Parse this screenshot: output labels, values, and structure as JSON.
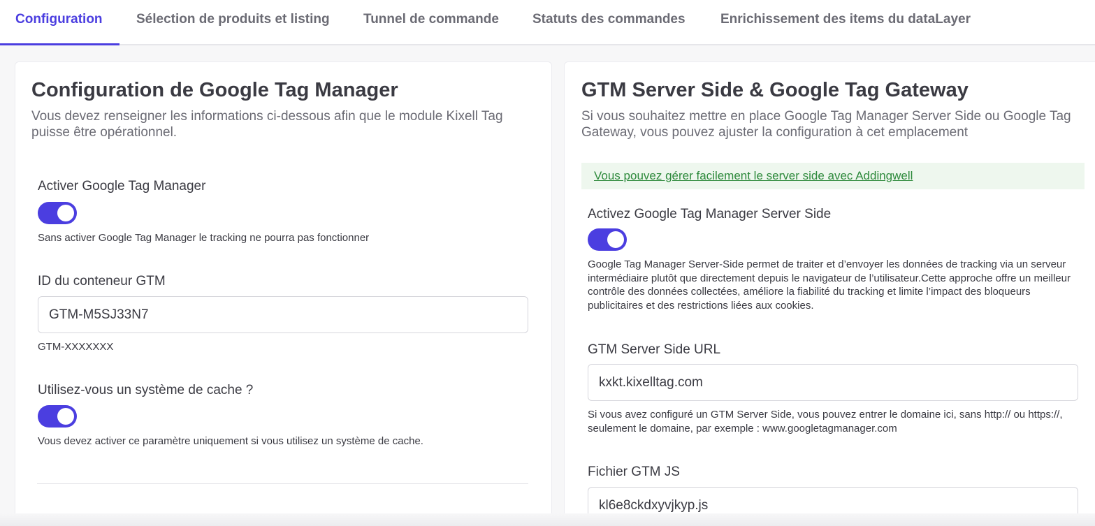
{
  "tabs": [
    {
      "label": "Configuration",
      "active": true
    },
    {
      "label": "Sélection de produits et listing",
      "active": false
    },
    {
      "label": "Tunnel de commande",
      "active": false
    },
    {
      "label": "Statuts des commandes",
      "active": false
    },
    {
      "label": "Enrichissement des items du dataLayer",
      "active": false
    }
  ],
  "left_card": {
    "title": "Configuration de Google Tag Manager",
    "description": "Vous devez renseigner les informations ci-dessous afin que le module Kixell Tag puisse être opérationnel.",
    "enable_gtm": {
      "label": "Activer Google Tag Manager",
      "enabled": true,
      "help": "Sans activer Google Tag Manager le tracking ne pourra pas fonctionner"
    },
    "container_id": {
      "label": "ID du conteneur GTM",
      "value": "GTM-M5SJ33N7",
      "help": "GTM-XXXXXXX"
    },
    "cache": {
      "label": "Utilisez-vous un système de cache ?",
      "enabled": true,
      "help": "Vous devez activer ce paramètre uniquement si vous utilisez un système de cache."
    }
  },
  "right_card": {
    "title": "GTM Server Side & Google Tag Gateway",
    "description": "Si vous souhaitez mettre en place Google Tag Manager Server Side ou Google Tag Gateway, vous pouvez ajuster la configuration à cet emplacement",
    "notice_link": "Vous pouvez gérer facilement le server side avec Addingwell",
    "server_side": {
      "label": "Activez Google Tag Manager Server Side",
      "enabled": true,
      "help": "Google Tag Manager Server-Side permet de traiter et d’envoyer les données de tracking via un serveur intermédiaire plutôt que directement depuis le navigateur de l’utilisateur.Cette approche offre un meilleur contrôle des données collectées, améliore la fiabilité du tracking et limite l’impact des bloqueurs publicitaires et des restrictions liées aux cookies."
    },
    "server_url": {
      "label": "GTM Server Side URL",
      "value": "kxkt.kixelltag.com",
      "help": "Si vous avez configuré un GTM Server Side, vous pouvez entrer le domaine ici, sans http:// ou https://, seulement le domaine, par exemple : www.googletagmanager.com"
    },
    "js_file": {
      "label": "Fichier GTM JS",
      "value": "kl6e8ckdxyvjkyp.js"
    }
  },
  "colors": {
    "accent": "#4b3ee0",
    "notice_bg": "#eef7ee",
    "notice_text": "#2e8a3c"
  }
}
